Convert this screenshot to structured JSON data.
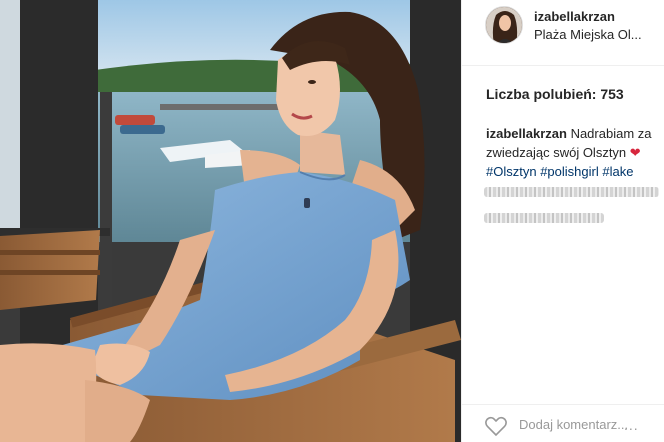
{
  "post": {
    "username": "izabellakrzan",
    "location": "Plaża Miejska Ol...",
    "likes_text": "Liczba polubień: 753",
    "caption": {
      "username": "izabellakrzan",
      "line1": "Nadrabiam za",
      "line2": "zwiedzając swój Olsztyn",
      "heart": "❤",
      "tags": [
        "#Olsztyn",
        "#polishgirl",
        "#lake"
      ]
    },
    "add_comment_placeholder": "Dodaj komentarz...",
    "more_label": "..."
  },
  "icons": {
    "like": "heart-outline-icon",
    "more": "ellipsis-icon"
  },
  "colors": {
    "text": "#262626",
    "hashtag": "#003569",
    "heart": "#d7263d",
    "muted": "#999999",
    "border": "#efefef"
  }
}
